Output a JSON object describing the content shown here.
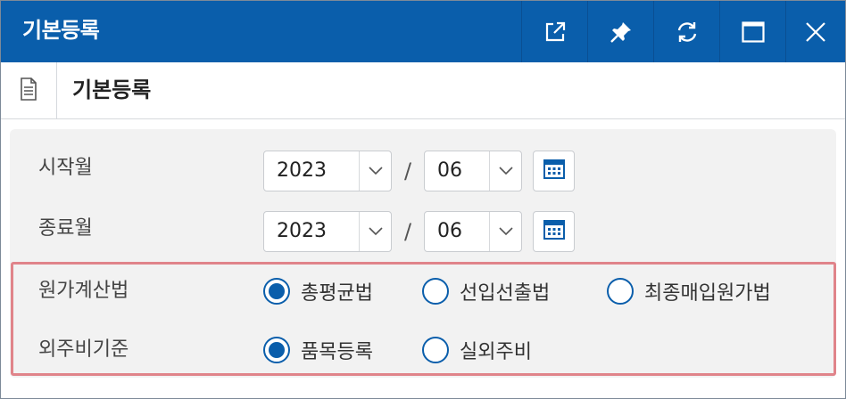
{
  "window": {
    "title": "기본등록"
  },
  "subheader": {
    "title": "기본등록"
  },
  "titlebar_buttons": [
    "popout-icon",
    "pin-icon",
    "refresh-icon",
    "maximize-icon",
    "close-icon"
  ],
  "colors": {
    "titlebar": "#0a5eab",
    "accent": "#0a5eab",
    "highlight_border": "#e0848a",
    "panel_bg": "#f2f2f2"
  },
  "form": {
    "start_month": {
      "label": "시작월",
      "year": "2023",
      "separator": "/",
      "month": "06"
    },
    "end_month": {
      "label": "종료월",
      "year": "2023",
      "separator": "/",
      "month": "06"
    },
    "cost_method": {
      "label": "원가계산법",
      "options": [
        {
          "label": "총평균법",
          "selected": true
        },
        {
          "label": "선입선출법",
          "selected": false
        },
        {
          "label": "최종매입원가법",
          "selected": false
        }
      ]
    },
    "outsourcing_basis": {
      "label": "외주비기준",
      "options": [
        {
          "label": "품목등록",
          "selected": true
        },
        {
          "label": "실외주비",
          "selected": false
        }
      ]
    }
  }
}
